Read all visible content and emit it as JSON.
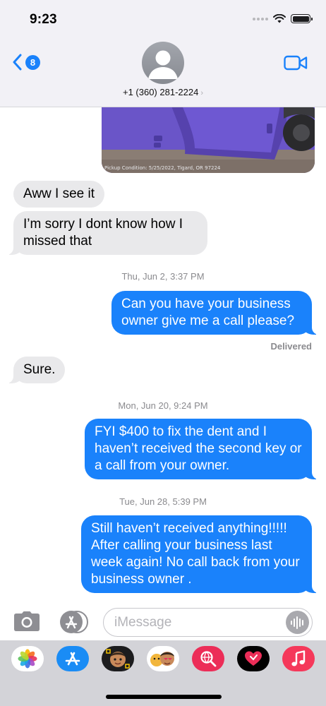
{
  "status_bar": {
    "time": "9:23"
  },
  "header": {
    "back_badge_count": "8",
    "contact_name": "+1 (360) 281-2224",
    "contact_chevron": "›",
    "icons": [
      "chevron-left-icon",
      "avatar-placeholder-icon",
      "video-camera-icon"
    ]
  },
  "photo": {
    "caption": "Pickup Condition: 5/25/2022, Tigard, OR 97224"
  },
  "messages": [
    {
      "direction": "incoming",
      "text": "Aww I see it"
    },
    {
      "direction": "incoming",
      "text": "I’m sorry I dont know how I missed that"
    },
    {
      "type": "timestamp",
      "text": "Thu, Jun 2, 3:37 PM"
    },
    {
      "direction": "outgoing",
      "text": "Can you have your business owner give me a call please?"
    },
    {
      "type": "status",
      "text": "Delivered"
    },
    {
      "direction": "incoming",
      "text": "Sure."
    },
    {
      "type": "timestamp",
      "text": "Mon, Jun 20, 9:24 PM"
    },
    {
      "direction": "outgoing",
      "text": "FYI $400 to fix the dent and I haven’t received the second key or a call from your owner."
    },
    {
      "type": "timestamp",
      "text": "Tue, Jun 28, 5:39 PM"
    },
    {
      "direction": "outgoing",
      "text": "Still haven’t received anything!!!!! After calling your business last week again! No call back from your business owner ."
    }
  ],
  "input_bar": {
    "placeholder": "iMessage"
  },
  "app_drawer": [
    {
      "name": "Photos",
      "icon": "photos-icon"
    },
    {
      "name": "App Store",
      "icon": "app-store-icon"
    },
    {
      "name": "Memoji",
      "icon": "memoji-icon"
    },
    {
      "name": "Memoji Stickers",
      "icon": "memoji-stickers-icon"
    },
    {
      "name": "Web Search",
      "icon": "search-globe-icon"
    },
    {
      "name": "Digital Touch",
      "icon": "digital-touch-heart-icon"
    },
    {
      "name": "Music",
      "icon": "music-icon"
    }
  ],
  "colors": {
    "accent": "#1a82fb",
    "incoming_bubble": "#e9e9eb",
    "header_bg": "#f2f1f6",
    "drawer_bg": "#d3d3d8"
  }
}
